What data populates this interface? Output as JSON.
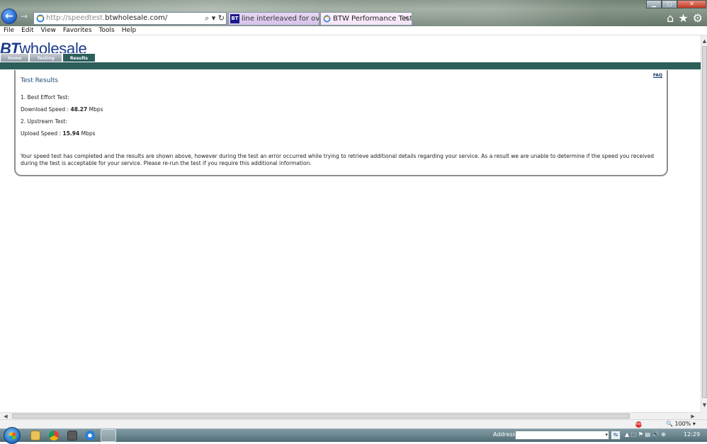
{
  "browser": {
    "url_prefix": "http://speedtest.",
    "url_domain": "btwholesale.com/",
    "tabs": [
      {
        "icon": "BT",
        "label": "line interleaved for over a mon..."
      },
      {
        "label": "BTW Performance Test",
        "close": "✕"
      }
    ],
    "controls": {
      "back": "←",
      "forward": "→",
      "search": "⌕ ▾ ↻",
      "minimize": "▁",
      "maximize": "▢",
      "close": "✕"
    },
    "command_icons": {
      "home": "⌂",
      "favorites": "★",
      "tools": "⚙"
    }
  },
  "menu": [
    "File",
    "Edit",
    "View",
    "Favorites",
    "Tools",
    "Help"
  ],
  "site": {
    "logo_bold": "BT",
    "logo_text": "wholesale",
    "nav": [
      {
        "label": "Home",
        "active": false
      },
      {
        "label": "Testing",
        "active": false
      },
      {
        "label": "Results",
        "active": true
      }
    ]
  },
  "results": {
    "faq": "FAQ",
    "title": "Test Results",
    "test1_label": "1. Best Effort Test:",
    "download_label": "Download Speed : ",
    "download_value": "48.27",
    "download_unit": " Mbps",
    "test2_label": "2. Upstream Test:",
    "upload_label": "Upload Speed : ",
    "upload_value": "15.94",
    "upload_unit": " Mbps",
    "message": "Your speed test has completed and the results are shown above, however during the test an error occurred while trying to retrieve additional details regarding your service. As a result we are unable to determine if the speed you received during the test is acceptable for your service. Please re-run the test if you require this additional information."
  },
  "scrollbar": {
    "up": "▲",
    "down": "▼",
    "left": "◀",
    "right": "▶"
  },
  "status": {
    "blocker": "stop",
    "zoom": "🔍 100%  ▾"
  },
  "taskbar": {
    "address_label": "Address",
    "address_dropdown": "▾",
    "address_go": "↹",
    "tray": "▲  ⬚  ⚑  ▤  🔊  ⊕",
    "clock": "12:29"
  },
  "colors": {
    "brand_green": "#2c5e5a",
    "brand_blue": "#1a3a8c",
    "title_blue": "#1e4a6e"
  }
}
